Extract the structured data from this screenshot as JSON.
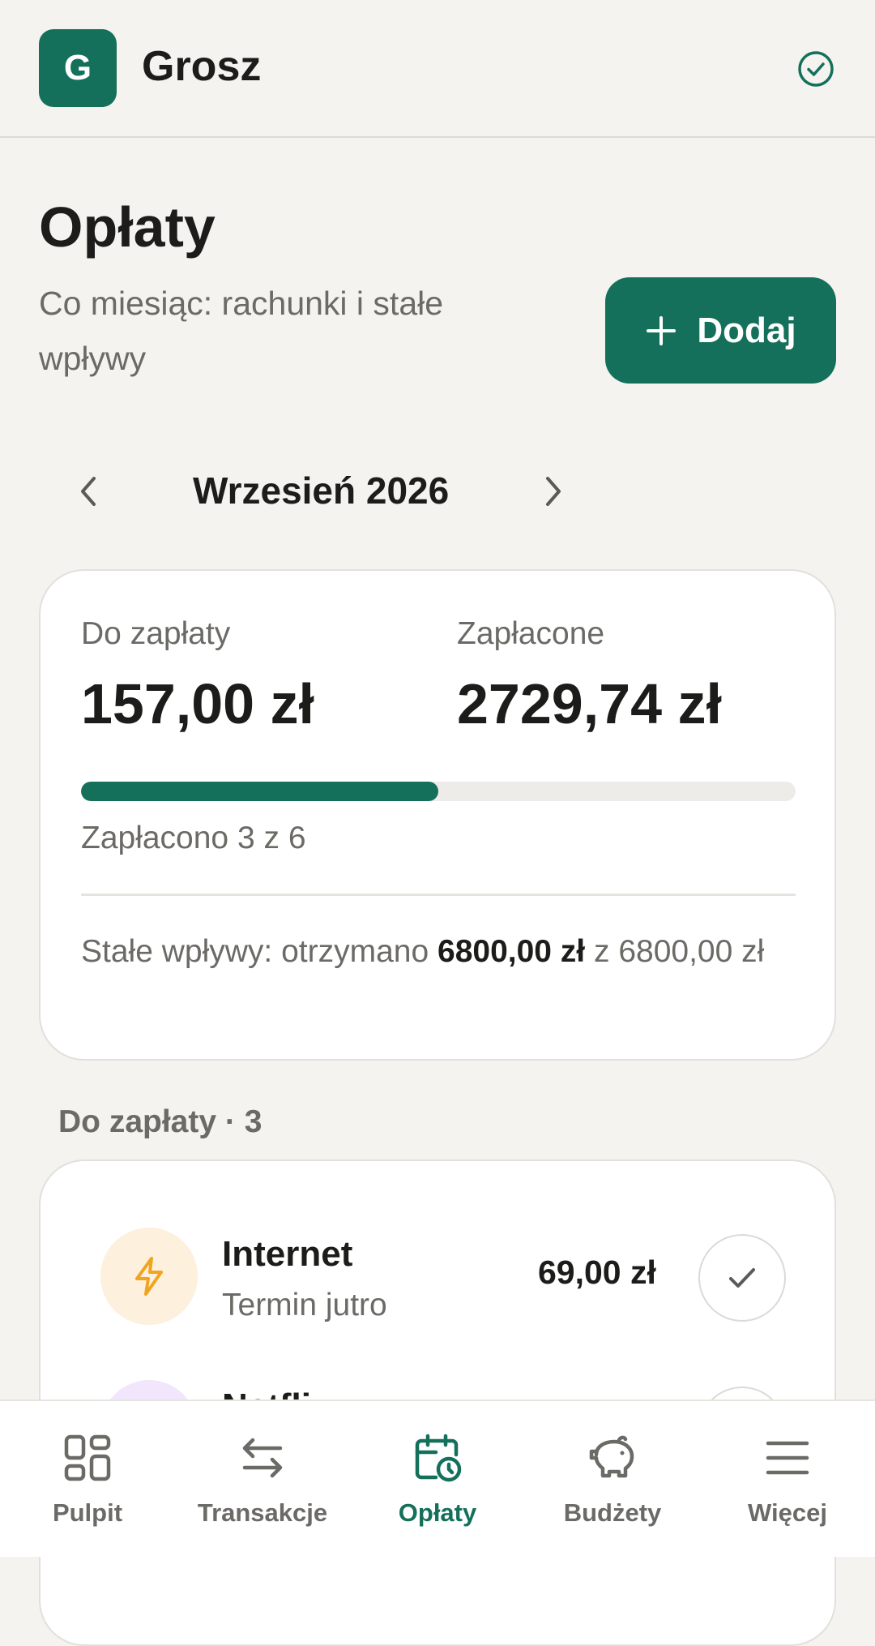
{
  "app": {
    "logo_letter": "G",
    "name": "Grosz",
    "status_icon": "check-circle-icon"
  },
  "page": {
    "title": "Opłaty",
    "subtitle": "Co miesiąc: rachunki i stałe wpływy",
    "add_button_label": "Dodaj"
  },
  "month_nav": {
    "label": "Wrzesień 2026"
  },
  "summary": {
    "due_label": "Do zapłaty",
    "due_value": "157,00 zł",
    "paid_label": "Zapłacone",
    "paid_value": "2729,74 zł",
    "progress_fraction": 0.5,
    "progress_text": "Zapłacono 3 z 6",
    "income_prefix": "Stałe wpływy: otrzymano",
    "income_received": "6800,00 zł",
    "income_suffix": "z 6800,00 zł"
  },
  "section": {
    "title": "Do zapłaty · 3"
  },
  "bills": [
    {
      "name": "Internet",
      "due": "Termin jutro",
      "amount": "69,00 zł",
      "icon": "lightning-icon",
      "icon_color": "#f0a420"
    },
    {
      "name": "Netfli",
      "icon": "streaming-icon",
      "icon_color": "#a66bd6"
    }
  ],
  "nav": [
    {
      "label": "Pulpit",
      "icon": "dashboard-icon"
    },
    {
      "label": "Transakcje",
      "icon": "transfer-arrows-icon"
    },
    {
      "label": "Opłaty",
      "icon": "calendar-clock-icon",
      "active": true
    },
    {
      "label": "Budżety",
      "icon": "piggy-bank-icon"
    },
    {
      "label": "Więcej",
      "icon": "menu-icon"
    }
  ],
  "colors": {
    "accent": "#14705a",
    "background": "#f5f3f0",
    "muted_text": "#6b6a66"
  }
}
